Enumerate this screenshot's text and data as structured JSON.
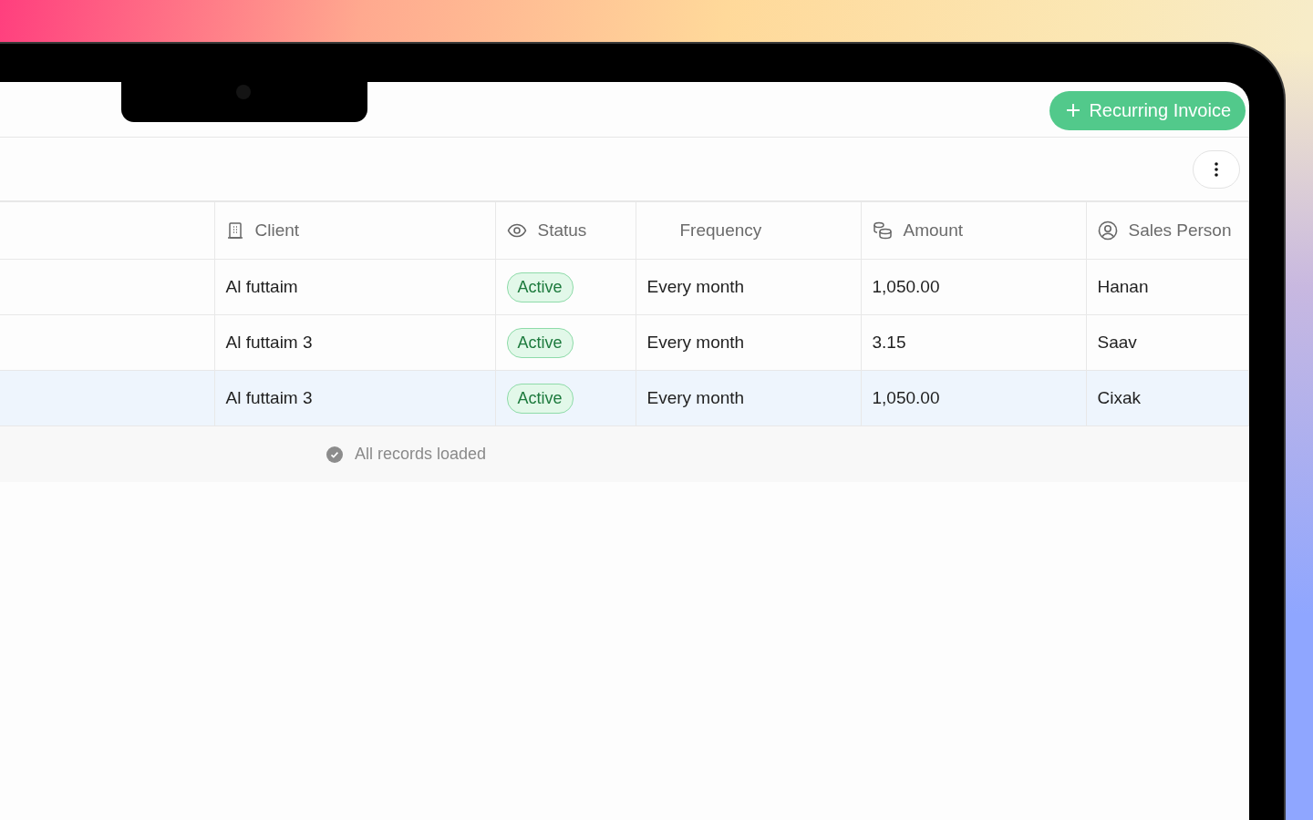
{
  "header": {
    "new_button": "Recurring Invoice"
  },
  "table": {
    "columns": [
      {
        "label": "Client"
      },
      {
        "label": "Status"
      },
      {
        "label": "Frequency"
      },
      {
        "label": "Amount"
      },
      {
        "label": "Sales Person"
      }
    ],
    "rows": [
      {
        "client": "Al futtaim",
        "status": "Active",
        "frequency": "Every month",
        "amount": "1,050.00",
        "sales_person": "Hanan",
        "selected": false
      },
      {
        "client": "Al futtaim 3",
        "status": "Active",
        "frequency": "Every month",
        "amount": "3.15",
        "sales_person": "Saav",
        "selected": false
      },
      {
        "client": "Al futtaim 3",
        "status": "Active",
        "frequency": "Every month",
        "amount": "1,050.00",
        "sales_person": "Cixak",
        "selected": true
      }
    ]
  },
  "footer": {
    "message": "All records loaded"
  }
}
